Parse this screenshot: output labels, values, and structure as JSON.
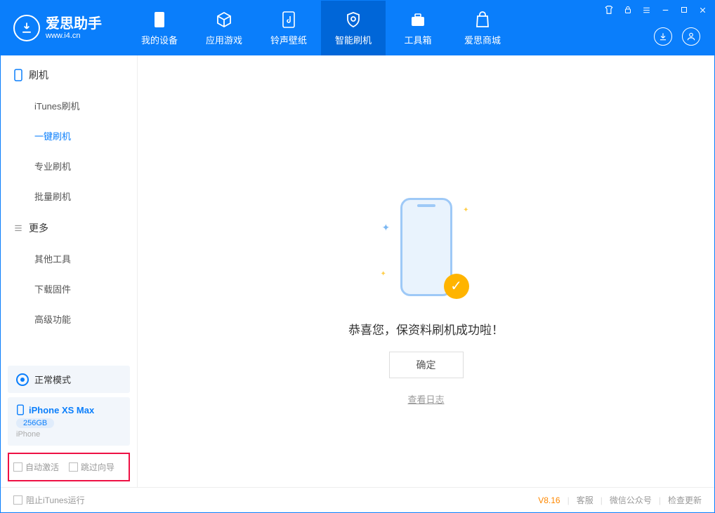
{
  "header": {
    "logo_title": "爱思助手",
    "logo_url": "www.i4.cn",
    "nav": [
      {
        "label": "我的设备"
      },
      {
        "label": "应用游戏"
      },
      {
        "label": "铃声壁纸"
      },
      {
        "label": "智能刷机"
      },
      {
        "label": "工具箱"
      },
      {
        "label": "爱思商城"
      }
    ]
  },
  "sidebar": {
    "group1": "刷机",
    "items1": [
      "iTunes刷机",
      "一键刷机",
      "专业刷机",
      "批量刷机"
    ],
    "group2": "更多",
    "items2": [
      "其他工具",
      "下载固件",
      "高级功能"
    ]
  },
  "device": {
    "mode": "正常模式",
    "name": "iPhone XS Max",
    "capacity": "256GB",
    "type": "iPhone"
  },
  "options": {
    "auto_activate": "自动激活",
    "skip_guide": "跳过向导"
  },
  "main": {
    "message": "恭喜您，保资料刷机成功啦！",
    "ok": "确定",
    "view_log": "查看日志"
  },
  "footer": {
    "block_itunes": "阻止iTunes运行",
    "version": "V8.16",
    "service": "客服",
    "wechat": "微信公众号",
    "update": "检查更新"
  }
}
